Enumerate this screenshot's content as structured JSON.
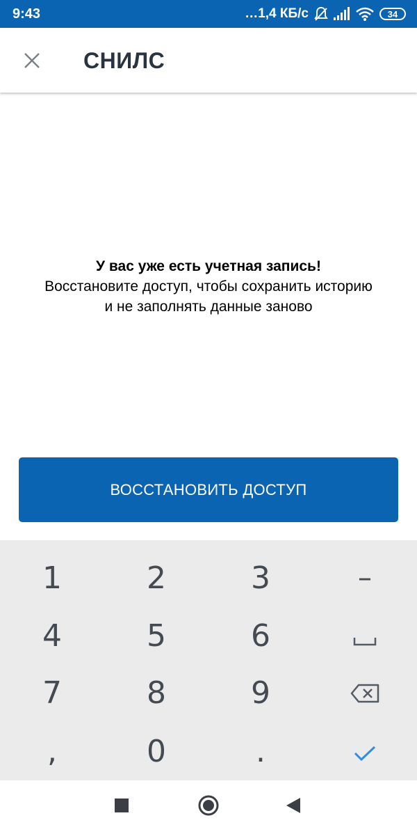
{
  "status_bar": {
    "time": "9:43",
    "network_speed": "…1,4 КБ/с",
    "battery_level": "34"
  },
  "app_bar": {
    "title": "СНИЛС",
    "close_icon": "close-icon"
  },
  "message": {
    "heading": "У вас уже есть учетная запись!",
    "line1": "Восстановите доступ, чтобы сохранить историю",
    "line2": "и не заполнять данные заново"
  },
  "button": {
    "restore_label": "ВОССТАНОВИТЬ ДОСТУП"
  },
  "keyboard": {
    "keys": [
      "1",
      "2",
      "3",
      "–",
      "4",
      "5",
      "6",
      "space",
      "7",
      "8",
      "9",
      "backspace",
      ",",
      "0",
      ".",
      "done"
    ],
    "digits": {
      "k1": "1",
      "k2": "2",
      "k3": "3",
      "dash": "–",
      "k4": "4",
      "k5": "5",
      "k6": "6",
      "k7": "7",
      "k8": "8",
      "k9": "9",
      "comma": ",",
      "k0": "0",
      "dot": "."
    }
  },
  "nav_bar": {
    "icons": [
      "recents-square-icon",
      "home-circle-icon",
      "back-triangle-icon"
    ]
  },
  "colors": {
    "primary": "#0b64b1",
    "keyboard_bg": "#ebebeb",
    "done_check": "#2f8ee0"
  }
}
